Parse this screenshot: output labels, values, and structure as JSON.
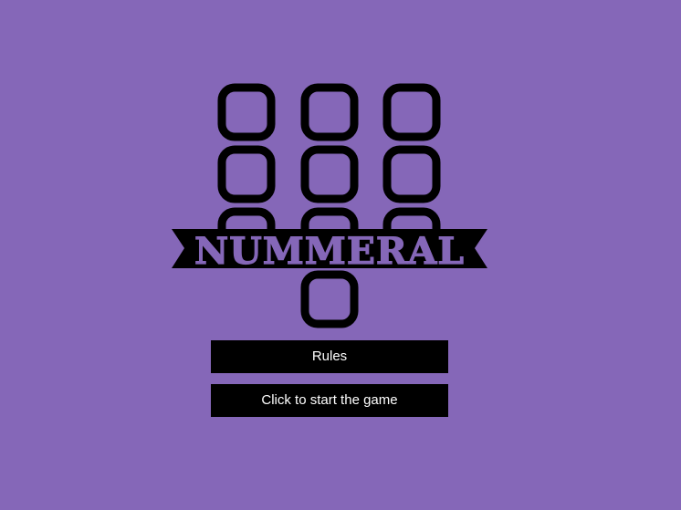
{
  "logo": {
    "title": "NUMMERAL",
    "icon": "numeral-grid-logo"
  },
  "menu": {
    "rules_label": "Rules",
    "start_label": "Click to start the game"
  },
  "colors": {
    "background": "#8567b8",
    "ink": "#000000",
    "button_text": "#ffffff"
  }
}
